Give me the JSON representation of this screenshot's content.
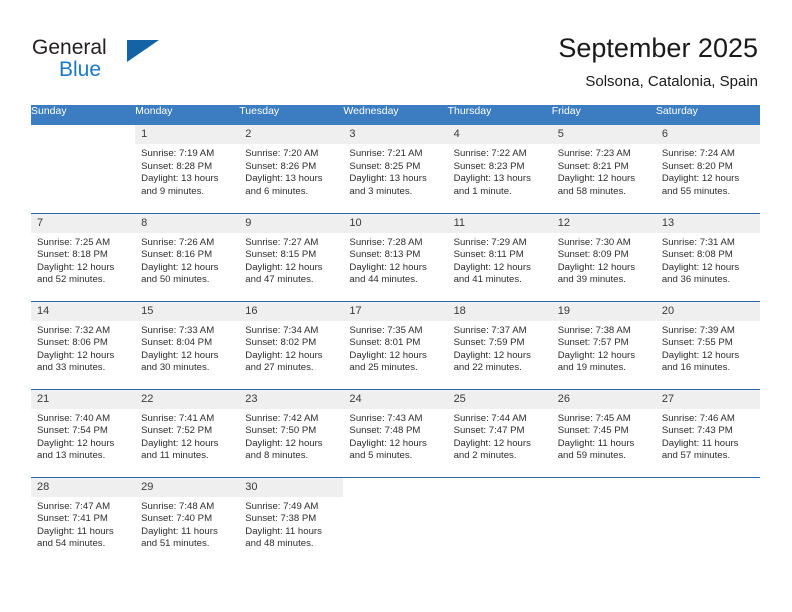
{
  "brand": {
    "name_part1": "General",
    "name_part2": "Blue",
    "logo_icon": "triangle-logo-icon",
    "accent_color": "#1464a5"
  },
  "header": {
    "title": "September 2025",
    "subtitle": "Solsona, Catalonia, Spain"
  },
  "calendar": {
    "header_bg": "#3b7dc0",
    "weekday_headers": [
      "Sunday",
      "Monday",
      "Tuesday",
      "Wednesday",
      "Thursday",
      "Friday",
      "Saturday"
    ],
    "weeks": [
      [
        {
          "day": "",
          "sunrise": "",
          "sunset": "",
          "daylight1": "",
          "daylight2": "",
          "blank": true
        },
        {
          "day": "1",
          "sunrise": "Sunrise: 7:19 AM",
          "sunset": "Sunset: 8:28 PM",
          "daylight1": "Daylight: 13 hours",
          "daylight2": "and 9 minutes."
        },
        {
          "day": "2",
          "sunrise": "Sunrise: 7:20 AM",
          "sunset": "Sunset: 8:26 PM",
          "daylight1": "Daylight: 13 hours",
          "daylight2": "and 6 minutes."
        },
        {
          "day": "3",
          "sunrise": "Sunrise: 7:21 AM",
          "sunset": "Sunset: 8:25 PM",
          "daylight1": "Daylight: 13 hours",
          "daylight2": "and 3 minutes."
        },
        {
          "day": "4",
          "sunrise": "Sunrise: 7:22 AM",
          "sunset": "Sunset: 8:23 PM",
          "daylight1": "Daylight: 13 hours",
          "daylight2": "and 1 minute."
        },
        {
          "day": "5",
          "sunrise": "Sunrise: 7:23 AM",
          "sunset": "Sunset: 8:21 PM",
          "daylight1": "Daylight: 12 hours",
          "daylight2": "and 58 minutes."
        },
        {
          "day": "6",
          "sunrise": "Sunrise: 7:24 AM",
          "sunset": "Sunset: 8:20 PM",
          "daylight1": "Daylight: 12 hours",
          "daylight2": "and 55 minutes."
        }
      ],
      [
        {
          "day": "7",
          "sunrise": "Sunrise: 7:25 AM",
          "sunset": "Sunset: 8:18 PM",
          "daylight1": "Daylight: 12 hours",
          "daylight2": "and 52 minutes."
        },
        {
          "day": "8",
          "sunrise": "Sunrise: 7:26 AM",
          "sunset": "Sunset: 8:16 PM",
          "daylight1": "Daylight: 12 hours",
          "daylight2": "and 50 minutes."
        },
        {
          "day": "9",
          "sunrise": "Sunrise: 7:27 AM",
          "sunset": "Sunset: 8:15 PM",
          "daylight1": "Daylight: 12 hours",
          "daylight2": "and 47 minutes."
        },
        {
          "day": "10",
          "sunrise": "Sunrise: 7:28 AM",
          "sunset": "Sunset: 8:13 PM",
          "daylight1": "Daylight: 12 hours",
          "daylight2": "and 44 minutes."
        },
        {
          "day": "11",
          "sunrise": "Sunrise: 7:29 AM",
          "sunset": "Sunset: 8:11 PM",
          "daylight1": "Daylight: 12 hours",
          "daylight2": "and 41 minutes."
        },
        {
          "day": "12",
          "sunrise": "Sunrise: 7:30 AM",
          "sunset": "Sunset: 8:09 PM",
          "daylight1": "Daylight: 12 hours",
          "daylight2": "and 39 minutes."
        },
        {
          "day": "13",
          "sunrise": "Sunrise: 7:31 AM",
          "sunset": "Sunset: 8:08 PM",
          "daylight1": "Daylight: 12 hours",
          "daylight2": "and 36 minutes."
        }
      ],
      [
        {
          "day": "14",
          "sunrise": "Sunrise: 7:32 AM",
          "sunset": "Sunset: 8:06 PM",
          "daylight1": "Daylight: 12 hours",
          "daylight2": "and 33 minutes."
        },
        {
          "day": "15",
          "sunrise": "Sunrise: 7:33 AM",
          "sunset": "Sunset: 8:04 PM",
          "daylight1": "Daylight: 12 hours",
          "daylight2": "and 30 minutes."
        },
        {
          "day": "16",
          "sunrise": "Sunrise: 7:34 AM",
          "sunset": "Sunset: 8:02 PM",
          "daylight1": "Daylight: 12 hours",
          "daylight2": "and 27 minutes."
        },
        {
          "day": "17",
          "sunrise": "Sunrise: 7:35 AM",
          "sunset": "Sunset: 8:01 PM",
          "daylight1": "Daylight: 12 hours",
          "daylight2": "and 25 minutes."
        },
        {
          "day": "18",
          "sunrise": "Sunrise: 7:37 AM",
          "sunset": "Sunset: 7:59 PM",
          "daylight1": "Daylight: 12 hours",
          "daylight2": "and 22 minutes."
        },
        {
          "day": "19",
          "sunrise": "Sunrise: 7:38 AM",
          "sunset": "Sunset: 7:57 PM",
          "daylight1": "Daylight: 12 hours",
          "daylight2": "and 19 minutes."
        },
        {
          "day": "20",
          "sunrise": "Sunrise: 7:39 AM",
          "sunset": "Sunset: 7:55 PM",
          "daylight1": "Daylight: 12 hours",
          "daylight2": "and 16 minutes."
        }
      ],
      [
        {
          "day": "21",
          "sunrise": "Sunrise: 7:40 AM",
          "sunset": "Sunset: 7:54 PM",
          "daylight1": "Daylight: 12 hours",
          "daylight2": "and 13 minutes."
        },
        {
          "day": "22",
          "sunrise": "Sunrise: 7:41 AM",
          "sunset": "Sunset: 7:52 PM",
          "daylight1": "Daylight: 12 hours",
          "daylight2": "and 11 minutes."
        },
        {
          "day": "23",
          "sunrise": "Sunrise: 7:42 AM",
          "sunset": "Sunset: 7:50 PM",
          "daylight1": "Daylight: 12 hours",
          "daylight2": "and 8 minutes."
        },
        {
          "day": "24",
          "sunrise": "Sunrise: 7:43 AM",
          "sunset": "Sunset: 7:48 PM",
          "daylight1": "Daylight: 12 hours",
          "daylight2": "and 5 minutes."
        },
        {
          "day": "25",
          "sunrise": "Sunrise: 7:44 AM",
          "sunset": "Sunset: 7:47 PM",
          "daylight1": "Daylight: 12 hours",
          "daylight2": "and 2 minutes."
        },
        {
          "day": "26",
          "sunrise": "Sunrise: 7:45 AM",
          "sunset": "Sunset: 7:45 PM",
          "daylight1": "Daylight: 11 hours",
          "daylight2": "and 59 minutes."
        },
        {
          "day": "27",
          "sunrise": "Sunrise: 7:46 AM",
          "sunset": "Sunset: 7:43 PM",
          "daylight1": "Daylight: 11 hours",
          "daylight2": "and 57 minutes."
        }
      ],
      [
        {
          "day": "28",
          "sunrise": "Sunrise: 7:47 AM",
          "sunset": "Sunset: 7:41 PM",
          "daylight1": "Daylight: 11 hours",
          "daylight2": "and 54 minutes."
        },
        {
          "day": "29",
          "sunrise": "Sunrise: 7:48 AM",
          "sunset": "Sunset: 7:40 PM",
          "daylight1": "Daylight: 11 hours",
          "daylight2": "and 51 minutes."
        },
        {
          "day": "30",
          "sunrise": "Sunrise: 7:49 AM",
          "sunset": "Sunset: 7:38 PM",
          "daylight1": "Daylight: 11 hours",
          "daylight2": "and 48 minutes."
        },
        {
          "day": "",
          "sunrise": "",
          "sunset": "",
          "daylight1": "",
          "daylight2": "",
          "blank": true
        },
        {
          "day": "",
          "sunrise": "",
          "sunset": "",
          "daylight1": "",
          "daylight2": "",
          "blank": true
        },
        {
          "day": "",
          "sunrise": "",
          "sunset": "",
          "daylight1": "",
          "daylight2": "",
          "blank": true
        },
        {
          "day": "",
          "sunrise": "",
          "sunset": "",
          "daylight1": "",
          "daylight2": "",
          "blank": true
        }
      ]
    ]
  }
}
